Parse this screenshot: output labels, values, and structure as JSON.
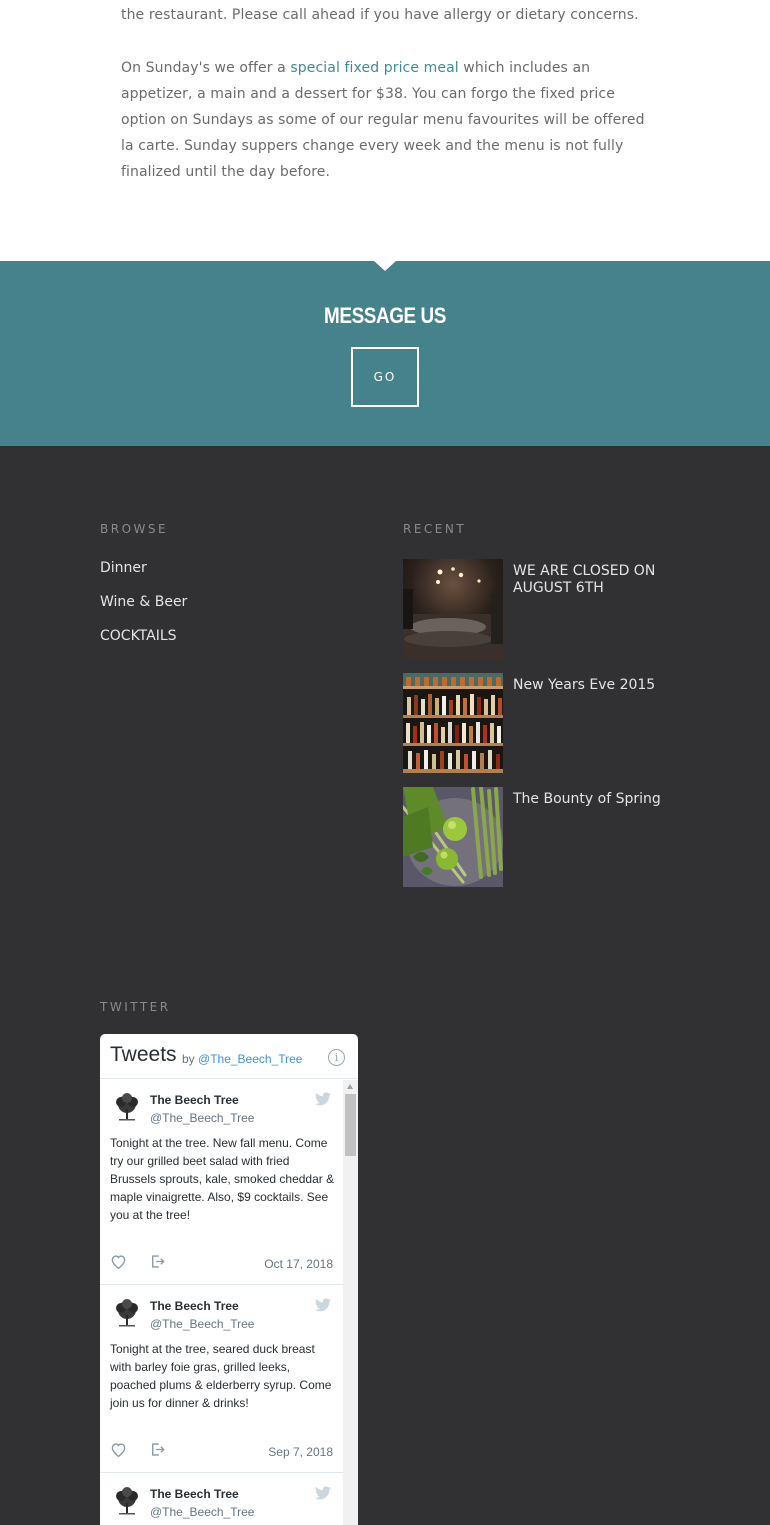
{
  "intro": {
    "p1": "the restaurant. Please call ahead if you have allergy or dietary concerns.",
    "p2_before": "On Sunday's we offer a ",
    "p2_link": "special fixed price meal",
    "p2_after": " which includes an appetizer, a main and a dessert for $38.  You can forgo the fixed price option on Sundays as some of our regular menu favourites will be offered la carte. Sunday suppers change every week and the menu is not fully finalized until the day before."
  },
  "message": {
    "title": "MESSAGE US",
    "button": "GO"
  },
  "footer": {
    "browse_title": "BROWSE",
    "browse_links": [
      "Dinner",
      "Wine & Beer",
      "COCKTAILS"
    ],
    "recent_title": "RECENT",
    "recent_items": [
      {
        "title": "WE ARE CLOSED ON AUGUST 6TH"
      },
      {
        "title": "New Years Eve 2015"
      },
      {
        "title": "The Bounty of Spring"
      }
    ],
    "twitter_title": "TWITTER"
  },
  "twitter": {
    "header": "Tweets",
    "by": "by ",
    "handle_link": "@The_Beech_Tree",
    "info_icon": "i",
    "tweets": [
      {
        "name": "The Beech Tree",
        "handle": "@The_Beech_Tree",
        "text": "Tonight at the tree. New fall menu. Come try our grilled beet salad with fried Brussels sprouts, kale, smoked cheddar & maple vinaigrette. Also, $9 cocktails. See you at the tree!",
        "date": "Oct 17, 2018"
      },
      {
        "name": "The Beech Tree",
        "handle": "@The_Beech_Tree",
        "text": "Tonight at the tree, seared duck breast with barley foie gras, grilled leeks, poached plums & elderberry syrup. Come join us for dinner & drinks!",
        "date": "Sep 7, 2018"
      },
      {
        "name": "The Beech Tree",
        "handle": "@The_Beech_Tree"
      }
    ]
  },
  "colors": {
    "accent_teal": "#46828c",
    "link_teal": "#3f8b95",
    "footer_bg": "#313133",
    "twitter_blue": "#3b94d9"
  }
}
